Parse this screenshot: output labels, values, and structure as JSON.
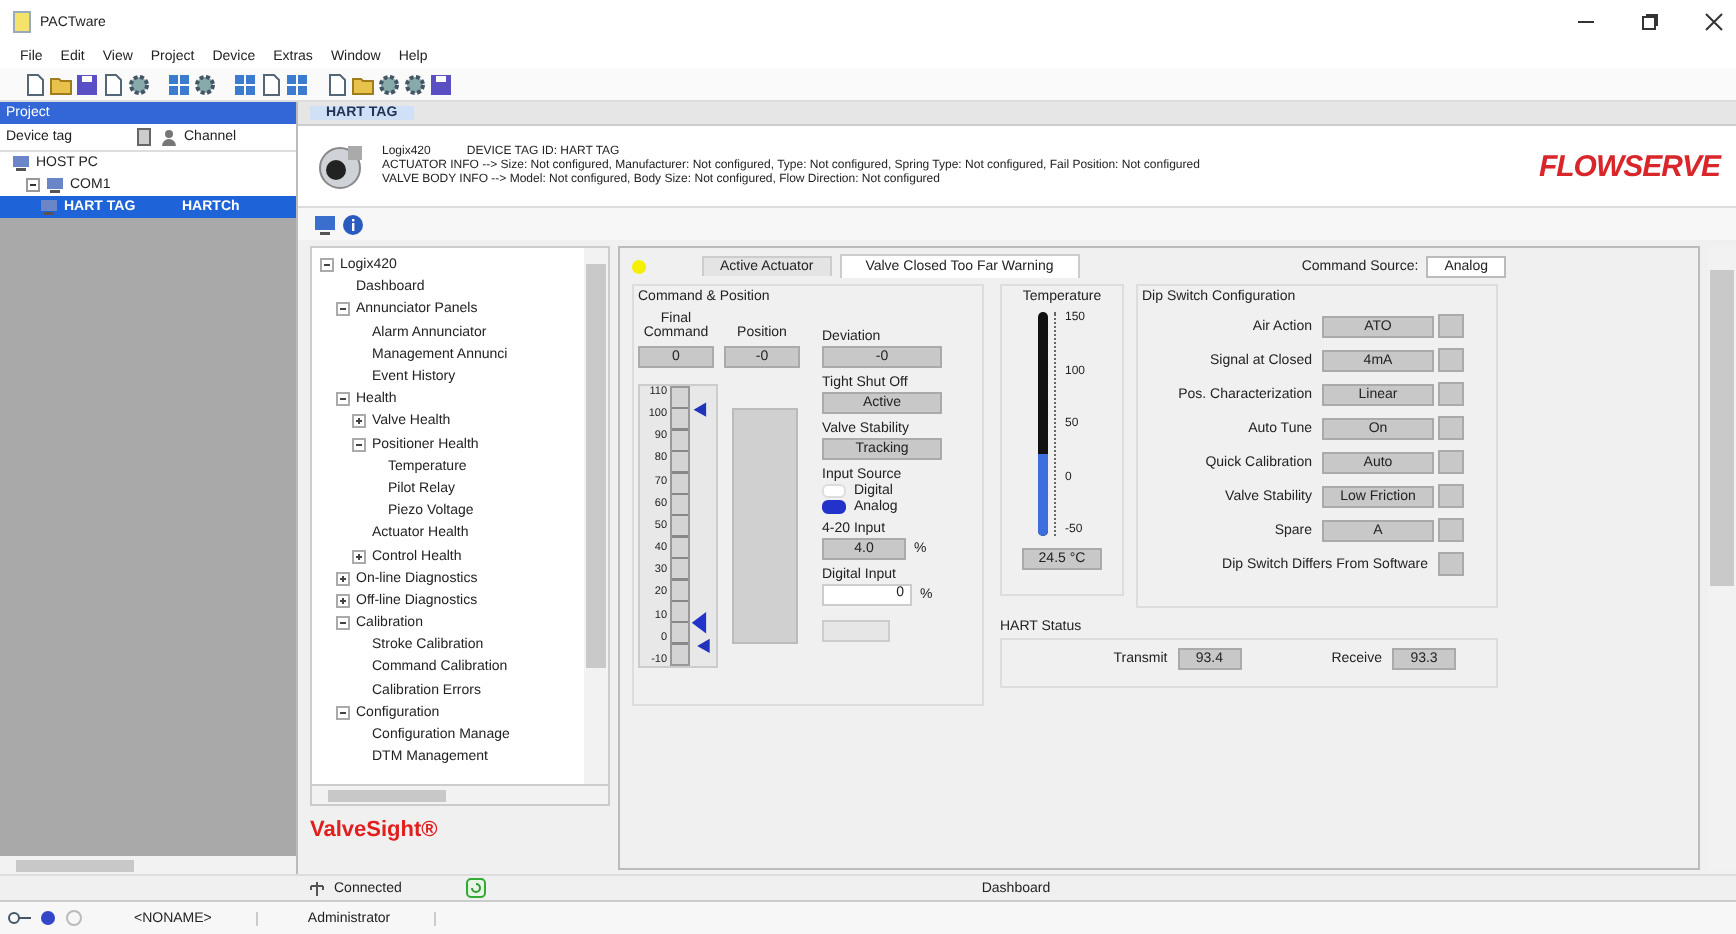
{
  "window": {
    "title": "PACTware"
  },
  "menu": [
    "File",
    "Edit",
    "View",
    "Project",
    "Device",
    "Extras",
    "Window",
    "Help"
  ],
  "project_panel": {
    "title": "Project",
    "columns": [
      "Device tag",
      "Channel"
    ],
    "tree": [
      {
        "label": "HOST PC",
        "selected": false,
        "children": [
          {
            "label": "COM1",
            "expanded": true,
            "selected": false,
            "children": [
              {
                "label": "HART TAG",
                "channel": "HARTCh",
                "selected": true
              }
            ]
          }
        ]
      }
    ]
  },
  "document_tab": {
    "label": "HART TAG"
  },
  "device_header": {
    "model": "Logix420",
    "tag": "DEVICE TAG ID: HART TAG",
    "lines": [
      "ACTUATOR INFO --> Size: Not configured, Manufacturer: Not configured, Type: Not configured, Spring Type: Not configured, Fail Position: Not configured",
      "VALVE BODY INFO --> Model: Not configured, Body Size: Not configured, Flow Direction: Not configured"
    ],
    "logo": "FLOWSERVE"
  },
  "nav_tree": [
    {
      "label": "Logix420",
      "expanded": true,
      "children": [
        {
          "label": "Dashboard"
        },
        {
          "label": "Annunciator Panels",
          "expanded": true,
          "children": [
            {
              "label": "Alarm Annunciator"
            },
            {
              "label": "Management Annunci"
            },
            {
              "label": "Event History"
            }
          ]
        },
        {
          "label": "Health",
          "expanded": true,
          "children": [
            {
              "label": "Valve Health",
              "expanded": false
            },
            {
              "label": "Positioner Health",
              "expanded": true,
              "children": [
                {
                  "label": "Temperature"
                },
                {
                  "label": "Pilot Relay"
                },
                {
                  "label": "Piezo Voltage"
                }
              ]
            },
            {
              "label": "Actuator Health"
            },
            {
              "label": "Control Health",
              "expanded": false
            }
          ]
        },
        {
          "label": "On-line Diagnostics",
          "expanded": false
        },
        {
          "label": "Off-line Diagnostics",
          "expanded": false
        },
        {
          "label": "Calibration",
          "expanded": true,
          "children": [
            {
              "label": "Stroke Calibration"
            },
            {
              "label": "Command Calibration"
            },
            {
              "label": "Calibration Errors"
            }
          ]
        },
        {
          "label": "Configuration",
          "expanded": true,
          "children": [
            {
              "label": "Configuration Manage"
            },
            {
              "label": "DTM Management"
            }
          ]
        }
      ]
    }
  ],
  "brand": "ValveSight®",
  "content": {
    "tabs": [
      {
        "label": "Active Actuator",
        "selected": false
      },
      {
        "label": "Valve Closed Too Far Warning",
        "selected": true
      }
    ],
    "command_source": {
      "label": "Command Source:",
      "value": "Analog"
    },
    "command_position": {
      "title": "Command & Position",
      "readouts": [
        {
          "label": "Final Command",
          "value": "0"
        },
        {
          "label": "Position",
          "value": "-0"
        }
      ],
      "scale": [
        "110",
        "100",
        "90",
        "80",
        "70",
        "60",
        "50",
        "40",
        "30",
        "20",
        "10",
        "0",
        "-10"
      ],
      "fields": [
        {
          "label": "Deviation",
          "value": "-0"
        },
        {
          "label": "Tight Shut Off",
          "value": "Active"
        },
        {
          "label": "Valve Stability",
          "value": "Tracking"
        }
      ],
      "input_source": {
        "label": "Input Source",
        "options": [
          {
            "label": "Digital",
            "selected": false
          },
          {
            "label": "Analog",
            "selected": true
          }
        ]
      },
      "analog_input": {
        "label": "4-20 Input",
        "value": "4.0",
        "unit": "%"
      },
      "digital_input": {
        "label": "Digital Input",
        "value": "0",
        "unit": "%"
      },
      "send_button": {
        "disabled": true
      }
    },
    "temperature": {
      "title": "Temperature",
      "scale": [
        "150",
        "100",
        "50",
        "0",
        "-50"
      ],
      "level": 0.37,
      "reading": "24.5 °C"
    },
    "dip_switch": {
      "title": "Dip Switch Configuration",
      "rows": [
        {
          "label": "Air Action",
          "value": "ATO"
        },
        {
          "label": "Signal at Closed",
          "value": "4mA"
        },
        {
          "label": "Pos. Characterization",
          "value": "Linear"
        },
        {
          "label": "Auto Tune",
          "value": "On"
        },
        {
          "label": "Quick Calibration",
          "value": "Auto"
        },
        {
          "label": "Valve Stability",
          "value": "Low Friction"
        },
        {
          "label": "Spare",
          "value": "A"
        }
      ],
      "differs": {
        "label": "Dip Switch Differs From Software",
        "checked": false
      }
    },
    "hart_status": {
      "title": "HART Status",
      "items": [
        {
          "label": "Transmit",
          "value": "93.4"
        },
        {
          "label": "Receive",
          "value": "93.3"
        }
      ]
    }
  },
  "status_bar": {
    "connection": "Connected",
    "view": "Dashboard"
  },
  "bottom_bar": {
    "project": "<NONAME>",
    "user": "Administrator"
  }
}
